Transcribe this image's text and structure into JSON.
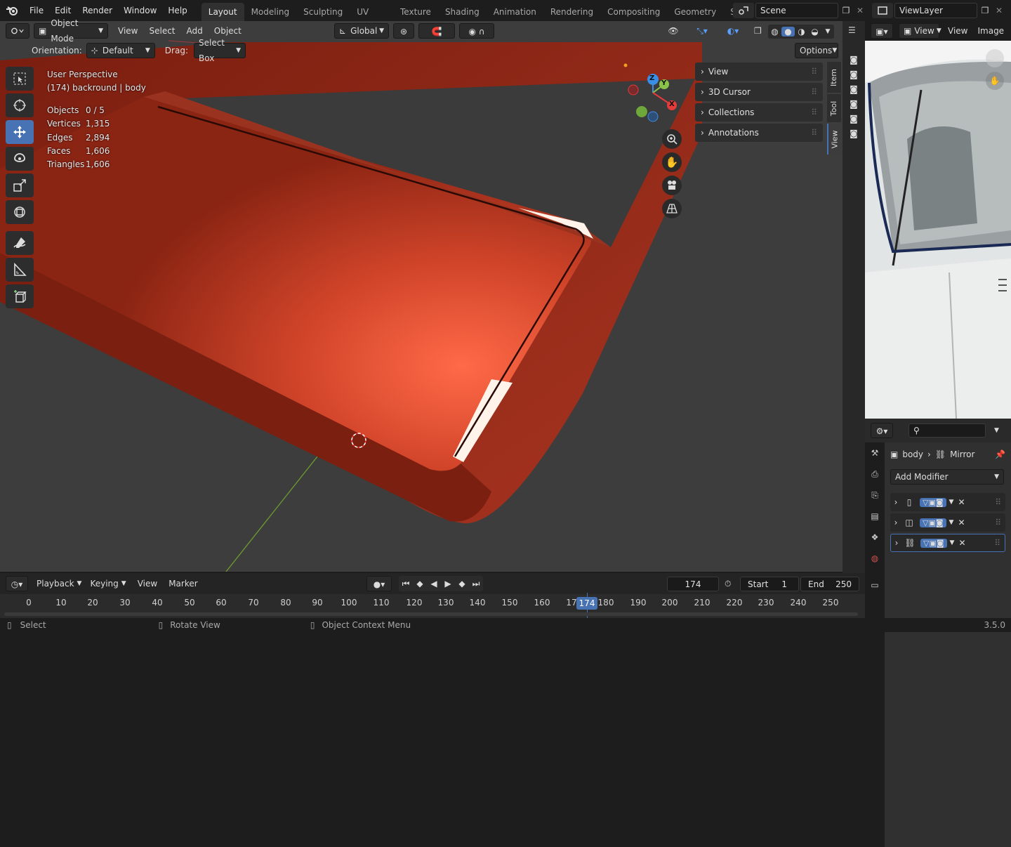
{
  "top_menu": [
    "File",
    "Edit",
    "Render",
    "Window",
    "Help"
  ],
  "workspaces": [
    {
      "label": "Layout",
      "active": true
    },
    {
      "label": "Modeling"
    },
    {
      "label": "Sculpting"
    },
    {
      "label": "UV Editing"
    },
    {
      "label": "Texture Paint"
    },
    {
      "label": "Shading"
    },
    {
      "label": "Animation"
    },
    {
      "label": "Rendering"
    },
    {
      "label": "Compositing"
    },
    {
      "label": "Geometry Nodes"
    },
    {
      "label": "Scripting"
    }
  ],
  "scene": "Scene",
  "view_layer": "ViewLayer",
  "viewport_header": {
    "mode": "Object Mode",
    "menus": [
      "View",
      "Select",
      "Add",
      "Object"
    ],
    "transform_orientation": "Global"
  },
  "tool_settings": {
    "orientation_label": "Orientation:",
    "orientation_value": "Default",
    "drag_label": "Drag:",
    "drag_value": "Select Box",
    "options": "Options"
  },
  "overlay_text": {
    "perspective": "User Perspective",
    "object": "(174) backround | body",
    "stats": [
      {
        "label": "Objects",
        "value": "0 / 5"
      },
      {
        "label": "Vertices",
        "value": "1,315"
      },
      {
        "label": "Edges",
        "value": "2,894"
      },
      {
        "label": "Faces",
        "value": "1,606"
      },
      {
        "label": "Triangles",
        "value": "1,606"
      }
    ]
  },
  "gizmo_axes": {
    "x": "X",
    "y": "Y",
    "z": "Z"
  },
  "n_panel": {
    "sections": [
      "View",
      "3D Cursor",
      "Collections",
      "Annotations"
    ],
    "tabs": [
      "Item",
      "Tool",
      "View"
    ]
  },
  "image_editor": {
    "menus": [
      "View",
      "View",
      "Image"
    ]
  },
  "properties": {
    "breadcrumb_object": "body",
    "breadcrumb_modifier": "Mirror",
    "add_modifier": "Add Modifier",
    "modifier_count": 3
  },
  "timeline": {
    "menus": [
      "Playback",
      "Keying",
      "View",
      "Marker"
    ],
    "current_frame": "174",
    "start_label": "Start",
    "start": "1",
    "end_label": "End",
    "end": "250",
    "ticks": [
      "0",
      "10",
      "20",
      "30",
      "40",
      "50",
      "60",
      "70",
      "80",
      "90",
      "100",
      "110",
      "120",
      "130",
      "140",
      "150",
      "160",
      "17",
      "180",
      "190",
      "200",
      "210",
      "220",
      "230",
      "240",
      "250"
    ],
    "playhead_label": "174"
  },
  "status_bar": {
    "select": "Select",
    "rotate": "Rotate View",
    "context": "Object Context Menu",
    "version": "3.5.0"
  },
  "colors": {
    "accent": "#4772b3",
    "object": "#c23a1e",
    "x_axis": "#e43b3b",
    "y_axis": "#8bc34a",
    "z_axis": "#3a8ee6"
  }
}
